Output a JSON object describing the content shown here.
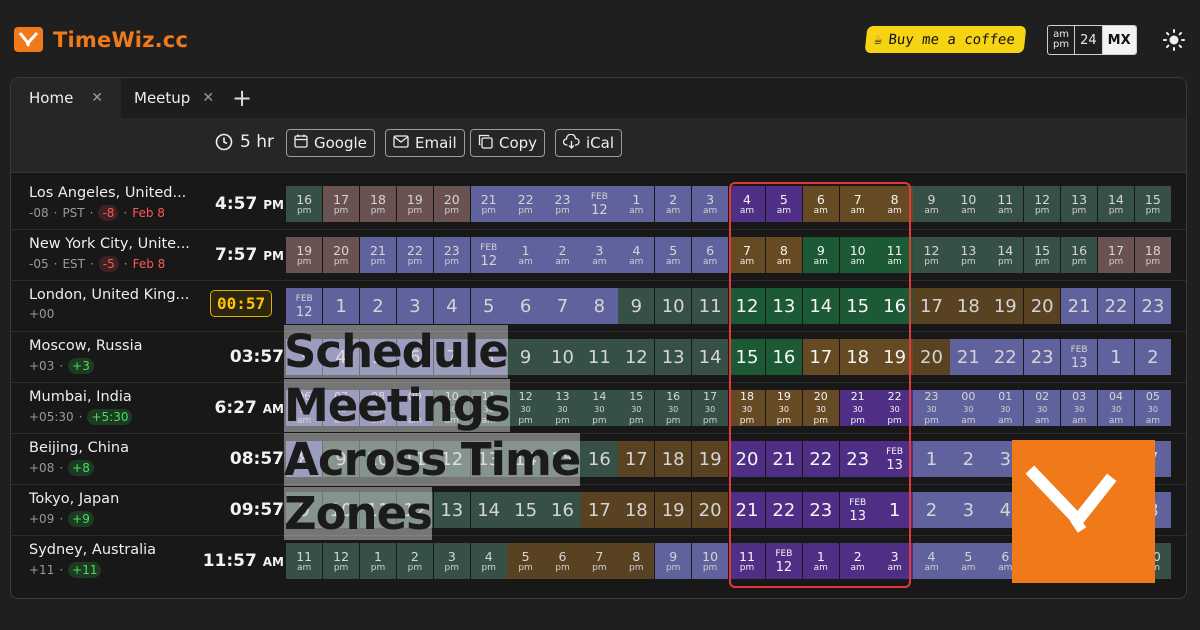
{
  "brand": {
    "name": "TimeWiz.cc",
    "accent": "#f07a1a"
  },
  "header": {
    "coffee_label": "Buy me a coffee",
    "fmt_ampm_top": "am",
    "fmt_ampm_bottom": "pm",
    "fmt_24": "24",
    "fmt_mx": "MX"
  },
  "tabs": [
    {
      "label": "Home"
    },
    {
      "label": "Meetup"
    }
  ],
  "toolbar": {
    "duration": "5 hr",
    "google": "Google",
    "email": "Email",
    "copy": "Copy",
    "ical": "iCal"
  },
  "rows": [
    {
      "city": "Los Angeles, United...",
      "offset": "-08",
      "abbr": "PST",
      "diff": "-8",
      "date": "Feb 8",
      "time": "4:57",
      "ampm": "PM"
    },
    {
      "city": "New York City, Unite...",
      "offset": "-05",
      "abbr": "EST",
      "diff": "-5",
      "date": "Feb 8",
      "time": "7:57",
      "ampm": "PM"
    },
    {
      "city": "London, United King...",
      "offset": "+00",
      "abbr": "",
      "diff": "",
      "date": "",
      "time": "00:57",
      "ampm": ""
    },
    {
      "city": "Moscow, Russia",
      "offset": "+03",
      "abbr": "",
      "diff": "+3",
      "date": "",
      "time": "03:57",
      "ampm": ""
    },
    {
      "city": "Mumbai, India",
      "offset": "+05:30",
      "abbr": "",
      "diff": "+5:30",
      "date": "",
      "time": "6:27",
      "ampm": "AM"
    },
    {
      "city": "Beijing, China",
      "offset": "+08",
      "abbr": "",
      "diff": "+8",
      "date": "",
      "time": "08:57",
      "ampm": ""
    },
    {
      "city": "Tokyo, Japan",
      "offset": "+09",
      "abbr": "",
      "diff": "+9",
      "date": "",
      "time": "09:57",
      "ampm": ""
    },
    {
      "city": "Sydney, Australia",
      "offset": "+11",
      "abbr": "",
      "diff": "+11",
      "date": "",
      "time": "11:57",
      "ampm": "AM"
    }
  ],
  "overlay": {
    "line1": "Schedule Meetings",
    "line2": "Across Time Zones"
  },
  "grid": {
    "colors": {
      "night": "#4f2f85",
      "evening": "#654a23",
      "work": "#1c5a35",
      "day": "#3d5a4f",
      "pm": "#7a5d5d",
      "violet": "#6c6fb5"
    }
  }
}
